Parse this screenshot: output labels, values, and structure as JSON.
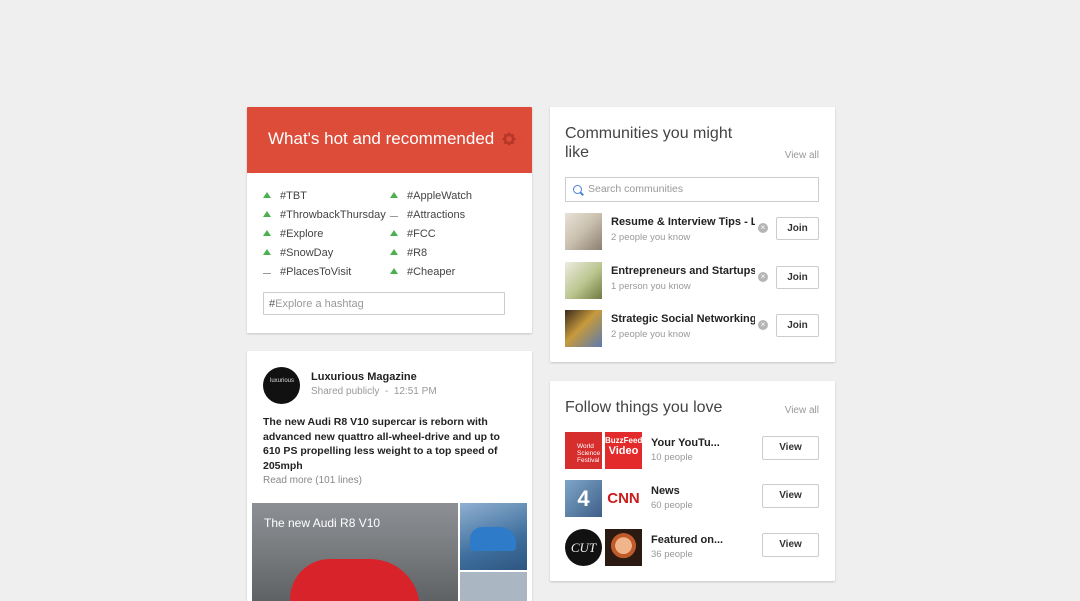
{
  "colors": {
    "hot_header": "#dd4b39",
    "trend_up": "#4caf50",
    "accent_blue": "#4a7fe0"
  },
  "hot": {
    "title": "What's hot and recommended",
    "settings_icon": "gear-icon",
    "trends": [
      {
        "tag": "#TBT",
        "trend": "up"
      },
      {
        "tag": "#ThrowbackThursday",
        "trend": "up"
      },
      {
        "tag": "#Explore",
        "trend": "up"
      },
      {
        "tag": "#SnowDay",
        "trend": "up"
      },
      {
        "tag": "#PlacesToVisit",
        "trend": "flat"
      },
      {
        "tag": "#AppleWatch",
        "trend": "up"
      },
      {
        "tag": "#Attractions",
        "trend": "flat"
      },
      {
        "tag": "#FCC",
        "trend": "up"
      },
      {
        "tag": "#R8",
        "trend": "up"
      },
      {
        "tag": "#Cheaper",
        "trend": "up"
      }
    ],
    "hashtag_prefix": "#",
    "hashtag_placeholder": "Explore a hashtag"
  },
  "post": {
    "author": "Luxurious Magazine",
    "avatar_text": "luxurious",
    "visibility": "Shared publicly",
    "separator": "-",
    "time": "12:51 PM",
    "text": "The new Audi R8 V10 supercar is reborn with advanced new quattro all-wheel-drive and up to 610 PS propelling less weight to a top speed of 205mph",
    "read_more": "Read more (101 lines)",
    "image_caption": "The new Audi R8 V10"
  },
  "communities": {
    "title_line1": "Communities you might",
    "title_line2": "like",
    "view_all": "View all",
    "search_placeholder": "Search communities",
    "items": [
      {
        "name": "Resume & Interview Tips - Li",
        "sub": "2 people you know",
        "button": "Join",
        "dismiss": "×"
      },
      {
        "name": "Entrepreneurs and Startups",
        "sub": "1 person you know",
        "button": "Join",
        "dismiss": "×"
      },
      {
        "name": "Strategic Social Networking",
        "sub": "2 people you know",
        "button": "Join",
        "dismiss": "×"
      }
    ]
  },
  "follow": {
    "title": "Follow things you love",
    "view_all": "View all",
    "items": [
      {
        "name": "Your YouTu...",
        "sub": "10 people",
        "button": "View",
        "logo1_text": "World Science Festival",
        "logo2_text_top": "BuzzFeed",
        "logo2_text_bottom": "Video"
      },
      {
        "name": "News",
        "sub": "60 people",
        "button": "View",
        "logo1_text": "4",
        "logo2_text_top": "CNN",
        "logo2_text_bottom": ""
      },
      {
        "name": "Featured on...",
        "sub": "36 people",
        "button": "View",
        "logo1_text": "CUT",
        "logo2_text_top": "",
        "logo2_text_bottom": ""
      }
    ]
  }
}
